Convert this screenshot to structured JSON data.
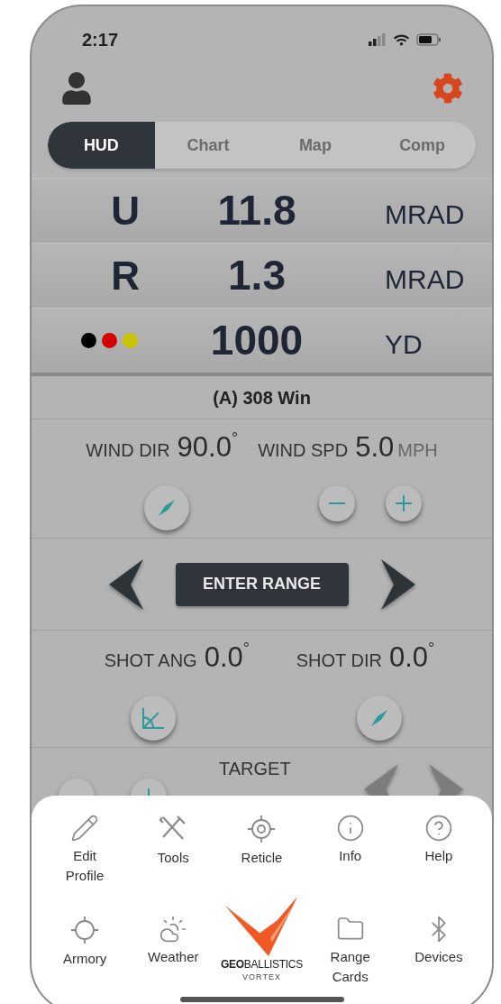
{
  "status_bar": {
    "time": "2:17"
  },
  "tabs": [
    {
      "label": "HUD",
      "selected": true
    },
    {
      "label": "Chart",
      "selected": false
    },
    {
      "label": "Map",
      "selected": false
    },
    {
      "label": "Comp",
      "selected": false
    }
  ],
  "readouts": [
    {
      "kind": "letter",
      "label": "U",
      "value": "11.8",
      "unit": "MRAD"
    },
    {
      "kind": "letter",
      "label": "R",
      "value": "1.3",
      "unit": "MRAD"
    },
    {
      "kind": "dots",
      "dots": [
        {
          "color": "#000000"
        },
        {
          "color": "#d40000"
        },
        {
          "color": "#c9c300"
        }
      ],
      "value": "1000",
      "unit": "YD"
    }
  ],
  "profile": "(A) 308 Win",
  "wind": {
    "direction": {
      "label": "WIND DIR",
      "value": "90.0",
      "unit": "°"
    },
    "speed": {
      "label": "WIND SPD",
      "value": "5.0",
      "unit": "MPH"
    }
  },
  "range_button": "ENTER RANGE",
  "shot": {
    "angle": {
      "label": "SHOT ANG",
      "value": "0.0",
      "unit": "°"
    },
    "direction": {
      "label": "SHOT DIR",
      "value": "0.0",
      "unit": "°"
    }
  },
  "target": {
    "label": "TARGET"
  },
  "menu": {
    "row_1": [
      {
        "label": "Edit Profile"
      },
      {
        "label": "Tools"
      },
      {
        "label": "Reticle"
      },
      {
        "label": "Info"
      },
      {
        "label": "Help"
      }
    ],
    "row_2": [
      {
        "label": "Armory"
      },
      {
        "label": "Weather"
      },
      {
        "kind": "logo",
        "wordmark": "**GEO**BALLISTICS",
        "subtitle": "VORTEX"
      },
      {
        "label": "Range Cards"
      },
      {
        "label": "Devices"
      }
    ]
  }
}
